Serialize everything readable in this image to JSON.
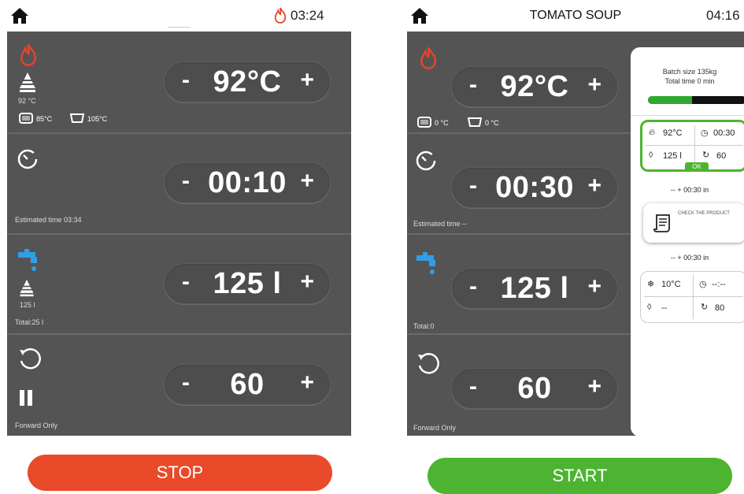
{
  "left": {
    "status": {
      "time": "03:24"
    },
    "temperature": {
      "value": "92°C",
      "setpoint_label": "92 °C",
      "sensor1": "85°C",
      "sensor2": "105°C"
    },
    "timer": {
      "value": "00:10",
      "estimated": "Estimated time 03:34"
    },
    "water": {
      "value": "125 l",
      "level_label": "125 l",
      "total": "Total:25 l"
    },
    "mixer": {
      "value": "60",
      "mode": "Forward Only"
    },
    "button": {
      "label": "STOP",
      "color": "#e84a2a"
    }
  },
  "right": {
    "header": {
      "title": "TOMATO SOUP",
      "time": "04:16"
    },
    "temperature": {
      "value": "92°C",
      "sensor1": "0 °C",
      "sensor2": "0 °C"
    },
    "timer": {
      "value": "00:30",
      "estimated": "Estimated time --"
    },
    "water": {
      "value": "125 l",
      "total": "Total:0"
    },
    "mixer": {
      "value": "60",
      "mode": "Forward Only"
    },
    "button": {
      "label": "START",
      "color": "#4db431"
    },
    "recipe": {
      "batch": "Batch size 135kg",
      "total_time": "Total time 0 min",
      "progress_fraction": 0.45,
      "step1": {
        "temp": "92°C",
        "time": "00:30",
        "water": "125 l",
        "mixer": "60",
        "ok": "OK"
      },
      "note1": "-- + 00:30 in",
      "check": "CHECK THE PRODUCT",
      "note2": "-- + 00:30 in",
      "step2": {
        "temp": "10°C",
        "time": "--:--",
        "water": "--",
        "mixer": "80"
      }
    }
  },
  "pill": {
    "minus": "-",
    "plus": "+"
  },
  "colors": {
    "panel": "#545454",
    "flame": "#e8432b",
    "water": "#2f9fe6",
    "stop": "#e84a2a",
    "start": "#4db431"
  }
}
